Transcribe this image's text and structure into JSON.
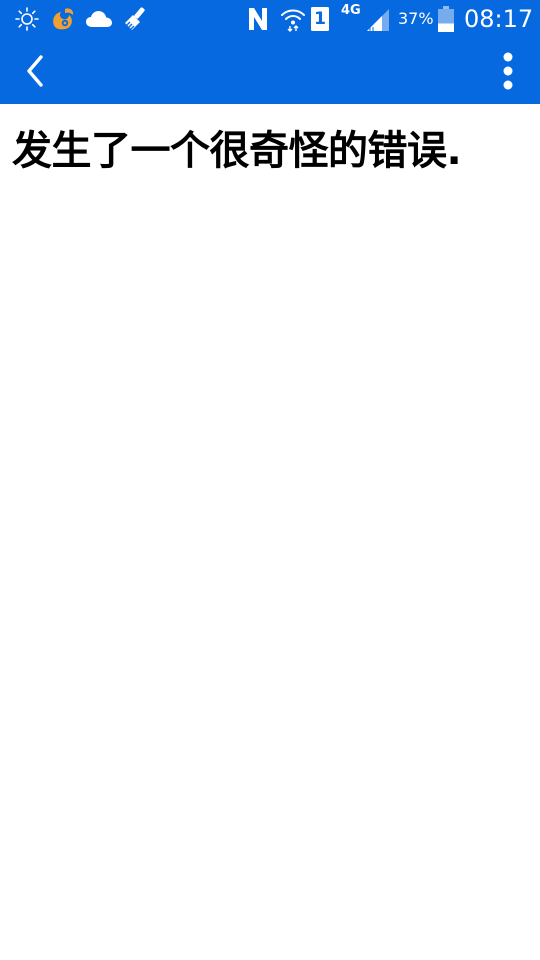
{
  "status_bar": {
    "icons_left": [
      "brightness-icon",
      "uc-browser-squirrel-icon",
      "cloud-icon",
      "cleaner-brush-icon"
    ],
    "icons_right": [
      "nfc-icon",
      "wifi-icon",
      "sim-1-icon",
      "signal-icon",
      "battery-icon"
    ],
    "network_type": "4G",
    "sim_slot": "1",
    "battery_percent": "37%",
    "battery_level": 0.37,
    "time": "08:17"
  },
  "app_bar": {
    "back_icon": "chevron-left-icon",
    "overflow_icon": "more-vert-icon"
  },
  "content": {
    "error_message": "发生了一个很奇怪的错误."
  },
  "colors": {
    "primary": "#0669e0",
    "status_icon": "#ffffff",
    "uc_icon": "#f0a030",
    "background": "#ffffff",
    "text": "#000000"
  }
}
